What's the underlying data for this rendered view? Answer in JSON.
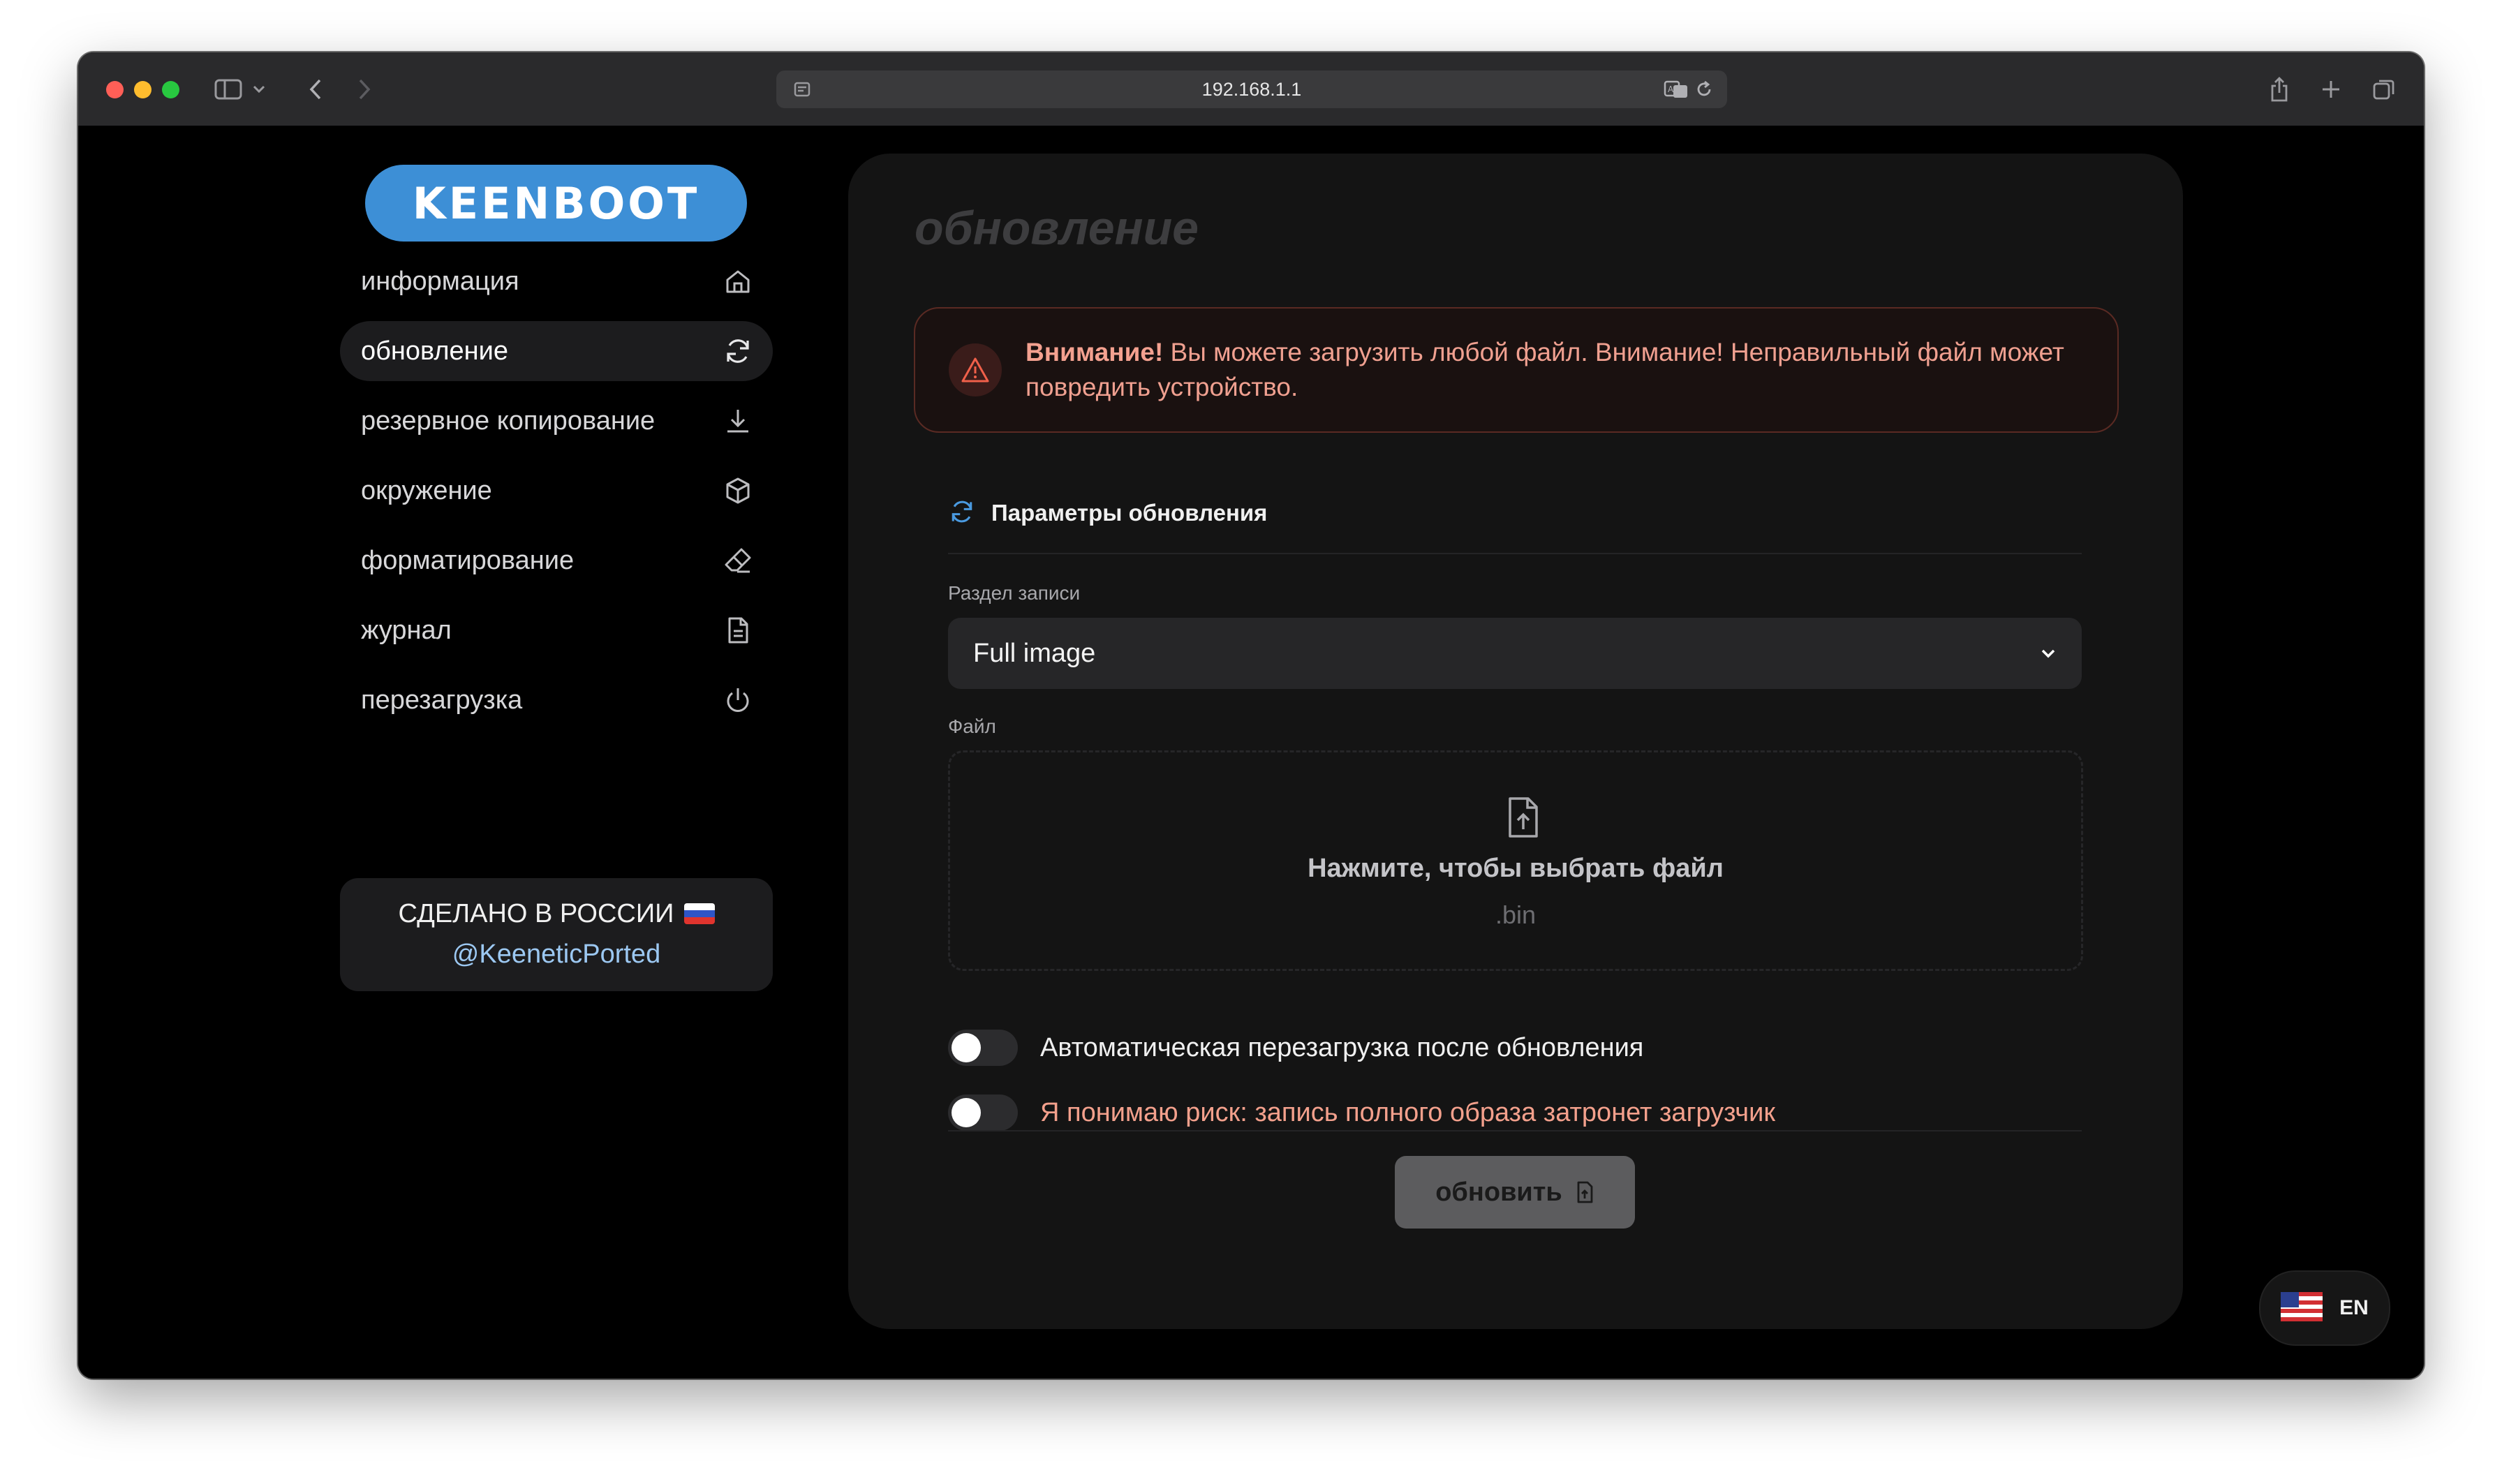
{
  "browser": {
    "url": "192.168.1.1"
  },
  "sidebar": {
    "logo": "KEENBOOT",
    "items": [
      {
        "label": "информация",
        "icon": "home-icon"
      },
      {
        "label": "обновление",
        "icon": "refresh-icon",
        "active": true
      },
      {
        "label": "резервное копирование",
        "icon": "download-icon"
      },
      {
        "label": "окружение",
        "icon": "box-icon"
      },
      {
        "label": "форматирование",
        "icon": "eraser-icon"
      },
      {
        "label": "журнал",
        "icon": "document-icon"
      },
      {
        "label": "перезагрузка",
        "icon": "power-icon"
      }
    ],
    "made_in": "СДЕЛАНО В РОССИИ",
    "made_link": "@KeeneticPorted"
  },
  "main": {
    "title": "обновление",
    "alert": {
      "strong": "Внимание!",
      "text": " Вы можете загрузить любой файл. Внимание! Неправильный файл может повредить устройство."
    },
    "section_title": "Параметры обновления",
    "partition_label": "Раздел записи",
    "partition_value": "Full image",
    "file_label": "Файл",
    "dropzone_text": "Нажмите, чтобы выбрать файл",
    "dropzone_ext": ".bin",
    "toggle_reboot": "Автоматическая перезагрузка после обновления",
    "toggle_risk": "Я понимаю риск: запись полного образа затронет загрузчик",
    "update_button": "обновить"
  },
  "language": {
    "code": "EN"
  },
  "colors": {
    "accent": "#3d8fd6",
    "warning_text": "#f0a090",
    "link": "#9cc8f2"
  }
}
